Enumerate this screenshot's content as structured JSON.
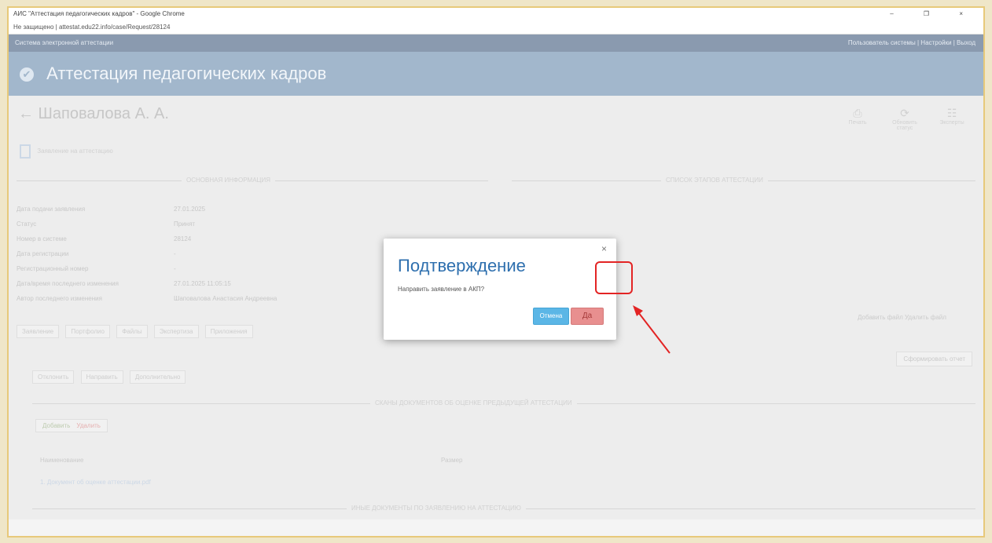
{
  "browser": {
    "window_title": "АИС \"Аттестация педагогических кадров\" - Google Chrome",
    "address": "Не защищено | attestat.edu22.info/case/Request/28124",
    "window_controls": "– ❐ ×"
  },
  "app": {
    "topbar_left": "Система электронной аттестации",
    "topbar_user": "Пользователь системы | Настройки | Выход",
    "header_title": "Аттестация педагогических кадров"
  },
  "page": {
    "person_title": "← Шаповалова А. А.",
    "tools": [
      {
        "icon": "print-icon",
        "glyph": "⎙",
        "label": "Печать"
      },
      {
        "icon": "refresh-icon",
        "glyph": "⟳",
        "label": "Обновить статус"
      },
      {
        "icon": "users-icon",
        "glyph": "☷",
        "label": "Эксперты"
      }
    ],
    "doc_link": "Заявление на аттестацию",
    "section_left": "ОСНОВНАЯ ИНФОРМАЦИЯ",
    "section_right": "СПИСОК ЭТАПОВ АТТЕСТАЦИИ",
    "fields": [
      {
        "label": "Дата подачи заявления",
        "value": "27.01.2025"
      },
      {
        "label": "Статус",
        "value": "Принят"
      },
      {
        "label": "Номер в системе",
        "value": "28124"
      },
      {
        "label": "Дата регистрации",
        "value": "-"
      },
      {
        "label": "Регистрационный номер",
        "value": "-"
      },
      {
        "label": "Дата/время последнего изменения",
        "value": "27.01.2025 11:05:15"
      },
      {
        "label": "Автор последнего изменения",
        "value": "Шаповалова Анастасия Андреевна"
      }
    ],
    "action_buttons": [
      "Заявление",
      "Портфолио",
      "Файлы",
      "Экспертиза",
      "Приложения"
    ],
    "second_buttons": [
      "Отклонить",
      "Направить",
      "Дополнительно"
    ],
    "right_links": "Добавить файл  Удалить файл",
    "right_button": "Сформировать отчет",
    "section_docs": "СКАНЫ ДОКУМЕНТОВ ОБ ОЦЕНКЕ ПРЕДЫДУЩЕЙ АТТЕСТАЦИИ",
    "section_other": "ИНЫЕ ДОКУМЕНТЫ ПО ЗАЯВЛЕНИЮ НА АТТЕСТАЦИЮ",
    "add_label": "Добавить",
    "delete_label": "Удалить",
    "table_header_name": "Наименование",
    "table_header_size": "Размер",
    "table_row_name": "1. Документ об оценке аттестации.pdf"
  },
  "modal": {
    "title": "Подтверждение",
    "message": "Направить заявление в АКП?",
    "ok_label": "Отмена",
    "no_label": "Да",
    "close": "×"
  },
  "colors": {
    "header_bg": "#a2b7cc",
    "modal_title": "#2e6fae",
    "ok_btn": "#5bb6e6",
    "no_btn": "#e88f8f",
    "annotation": "#e32424"
  }
}
